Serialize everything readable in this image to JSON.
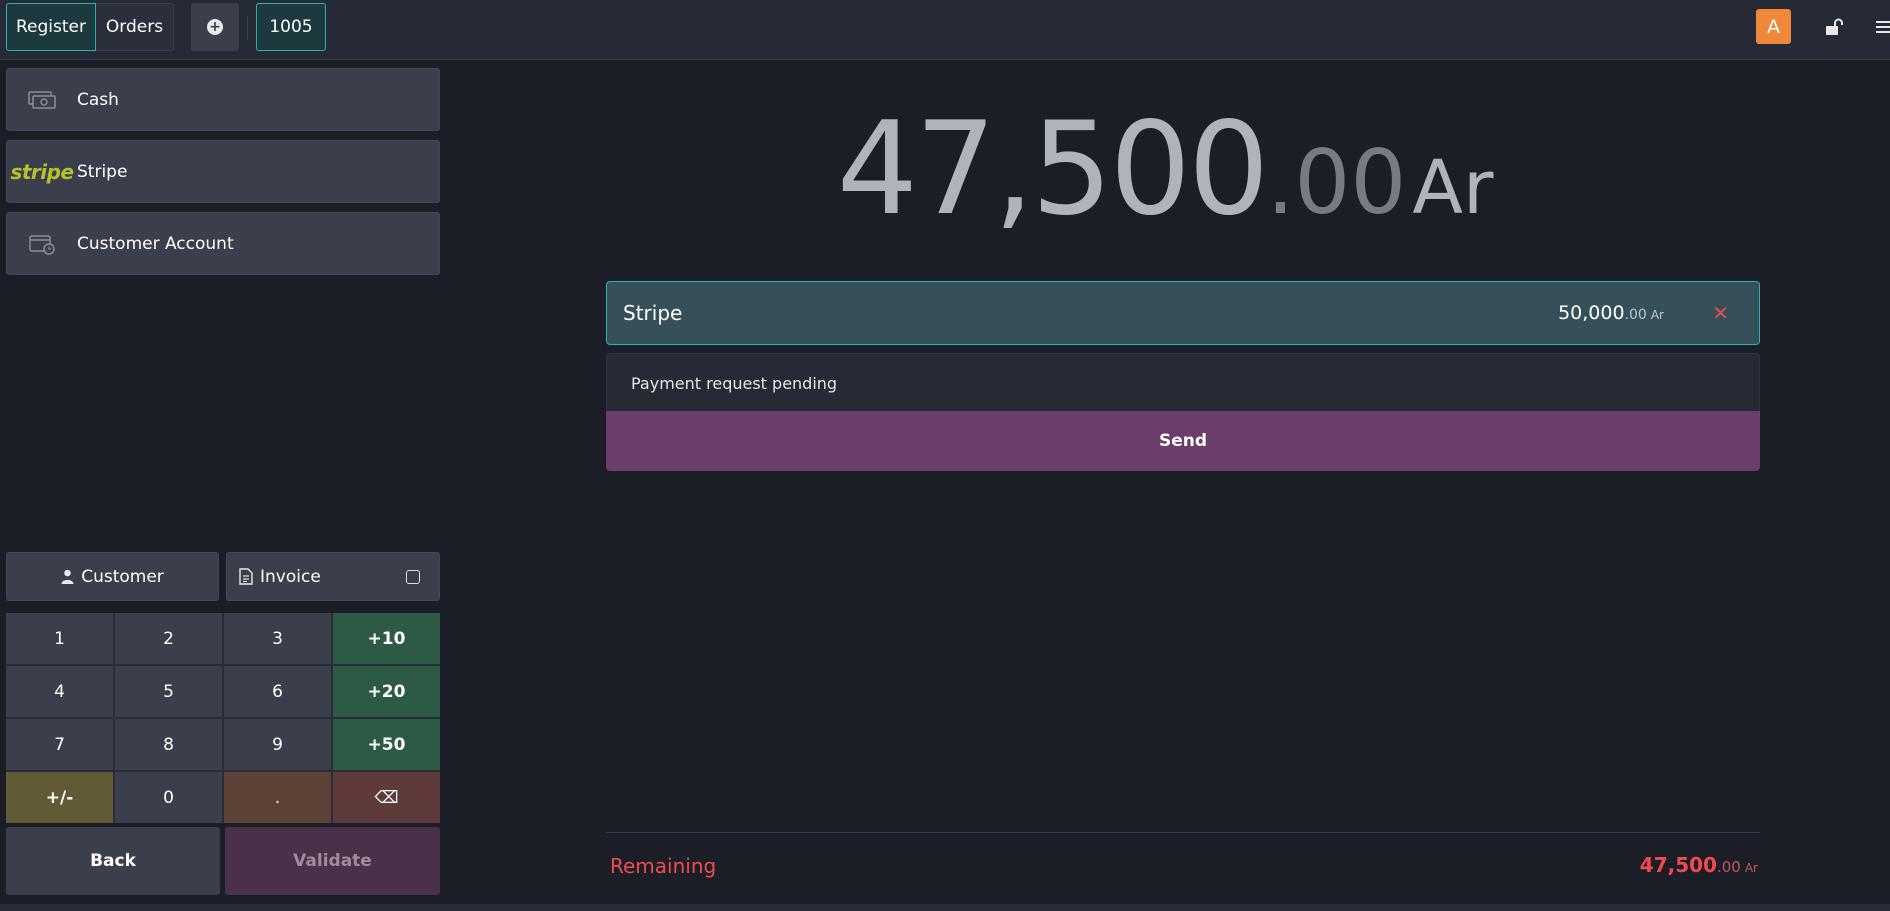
{
  "topbar": {
    "tab_register": "Register",
    "tab_orders": "Orders",
    "order_number": "1005",
    "avatar_letter": "A"
  },
  "payment_methods": [
    {
      "label": "Cash",
      "icon": "cash-icon"
    },
    {
      "label": "Stripe",
      "icon": "stripe-logo",
      "logo_text": "stripe"
    },
    {
      "label": "Customer Account",
      "icon": "wallet-clock-icon"
    }
  ],
  "actions": {
    "customer": "Customer",
    "invoice": "Invoice"
  },
  "numpad": {
    "keys": [
      "1",
      "2",
      "3",
      "+10",
      "4",
      "5",
      "6",
      "+20",
      "7",
      "8",
      "9",
      "+50",
      "+/-",
      "0",
      ".",
      "⌫"
    ]
  },
  "footer_buttons": {
    "back": "Back",
    "validate": "Validate"
  },
  "total": {
    "integer": "47,500",
    "decimal": ".00",
    "currency": "Ar"
  },
  "payment_line": {
    "method": "Stripe",
    "amount_integer": "50,000",
    "amount_decimal": ".00",
    "currency": "Ar"
  },
  "pending": {
    "text": "Payment request pending",
    "send": "Send"
  },
  "remaining": {
    "label": "Remaining",
    "integer": "47,500",
    "decimal": ".00",
    "currency": "Ar"
  },
  "colors": {
    "accent": "#27b4a9",
    "send": "#6b3d69",
    "remaining": "#ef4b4f",
    "avatar": "#f0883a",
    "numpad_green": "#2c5a45"
  }
}
